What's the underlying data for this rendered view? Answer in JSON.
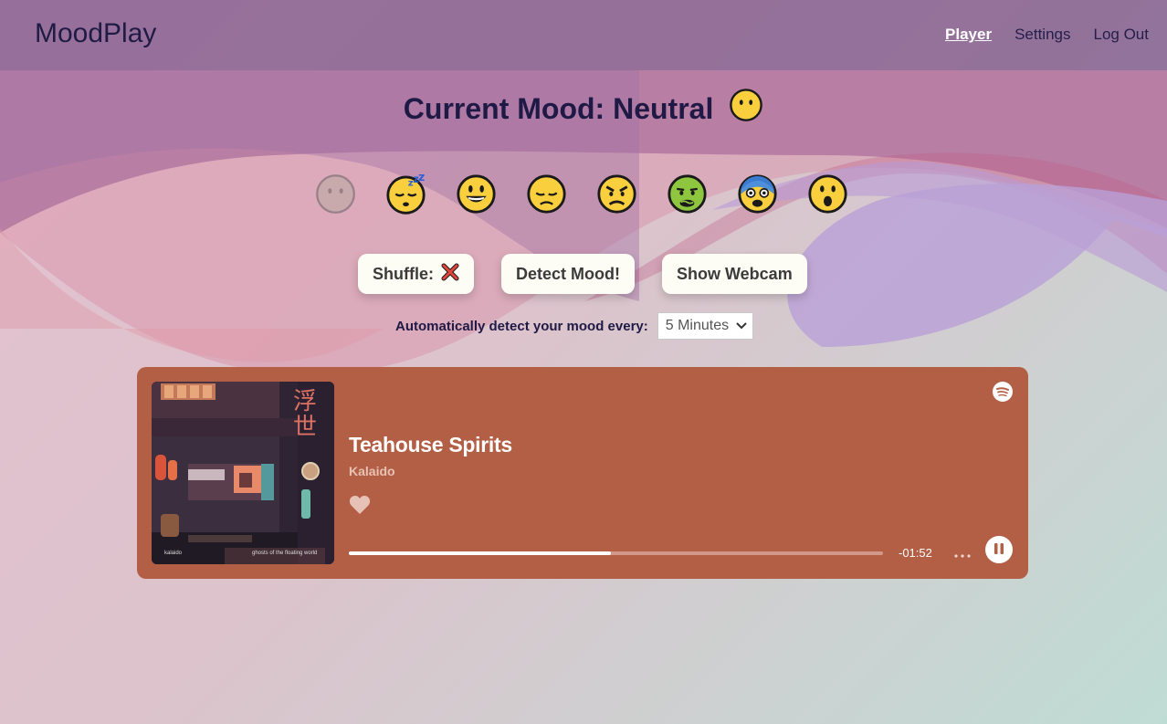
{
  "header": {
    "brand": "MoodPlay",
    "nav": [
      {
        "label": "Player",
        "active": true
      },
      {
        "label": "Settings",
        "active": false
      },
      {
        "label": "Log Out",
        "active": false
      }
    ]
  },
  "mood": {
    "title": "Current Mood: Neutral",
    "current_icon": "neutral-face-icon",
    "options": [
      "neutral",
      "sleepy",
      "happy",
      "sad",
      "angry",
      "sick",
      "fearful",
      "surprised"
    ]
  },
  "controls": {
    "shuffle_label": "Shuffle:",
    "shuffle_icon": "cross-mark-icon",
    "detect_label": "Detect Mood!",
    "webcam_label": "Show Webcam",
    "auto_detect_label": "Automatically detect your mood every:",
    "interval_value": "5 Minutes"
  },
  "player": {
    "track_title": "Teahouse Spirits",
    "artist": "Kalaido",
    "album_art_text_left": "kalaido",
    "album_art_text_right": "ghosts of the floating world",
    "time_remaining": "-01:52",
    "progress_fraction": 0.49,
    "is_playing": true,
    "bg_color": "#b25f45"
  }
}
